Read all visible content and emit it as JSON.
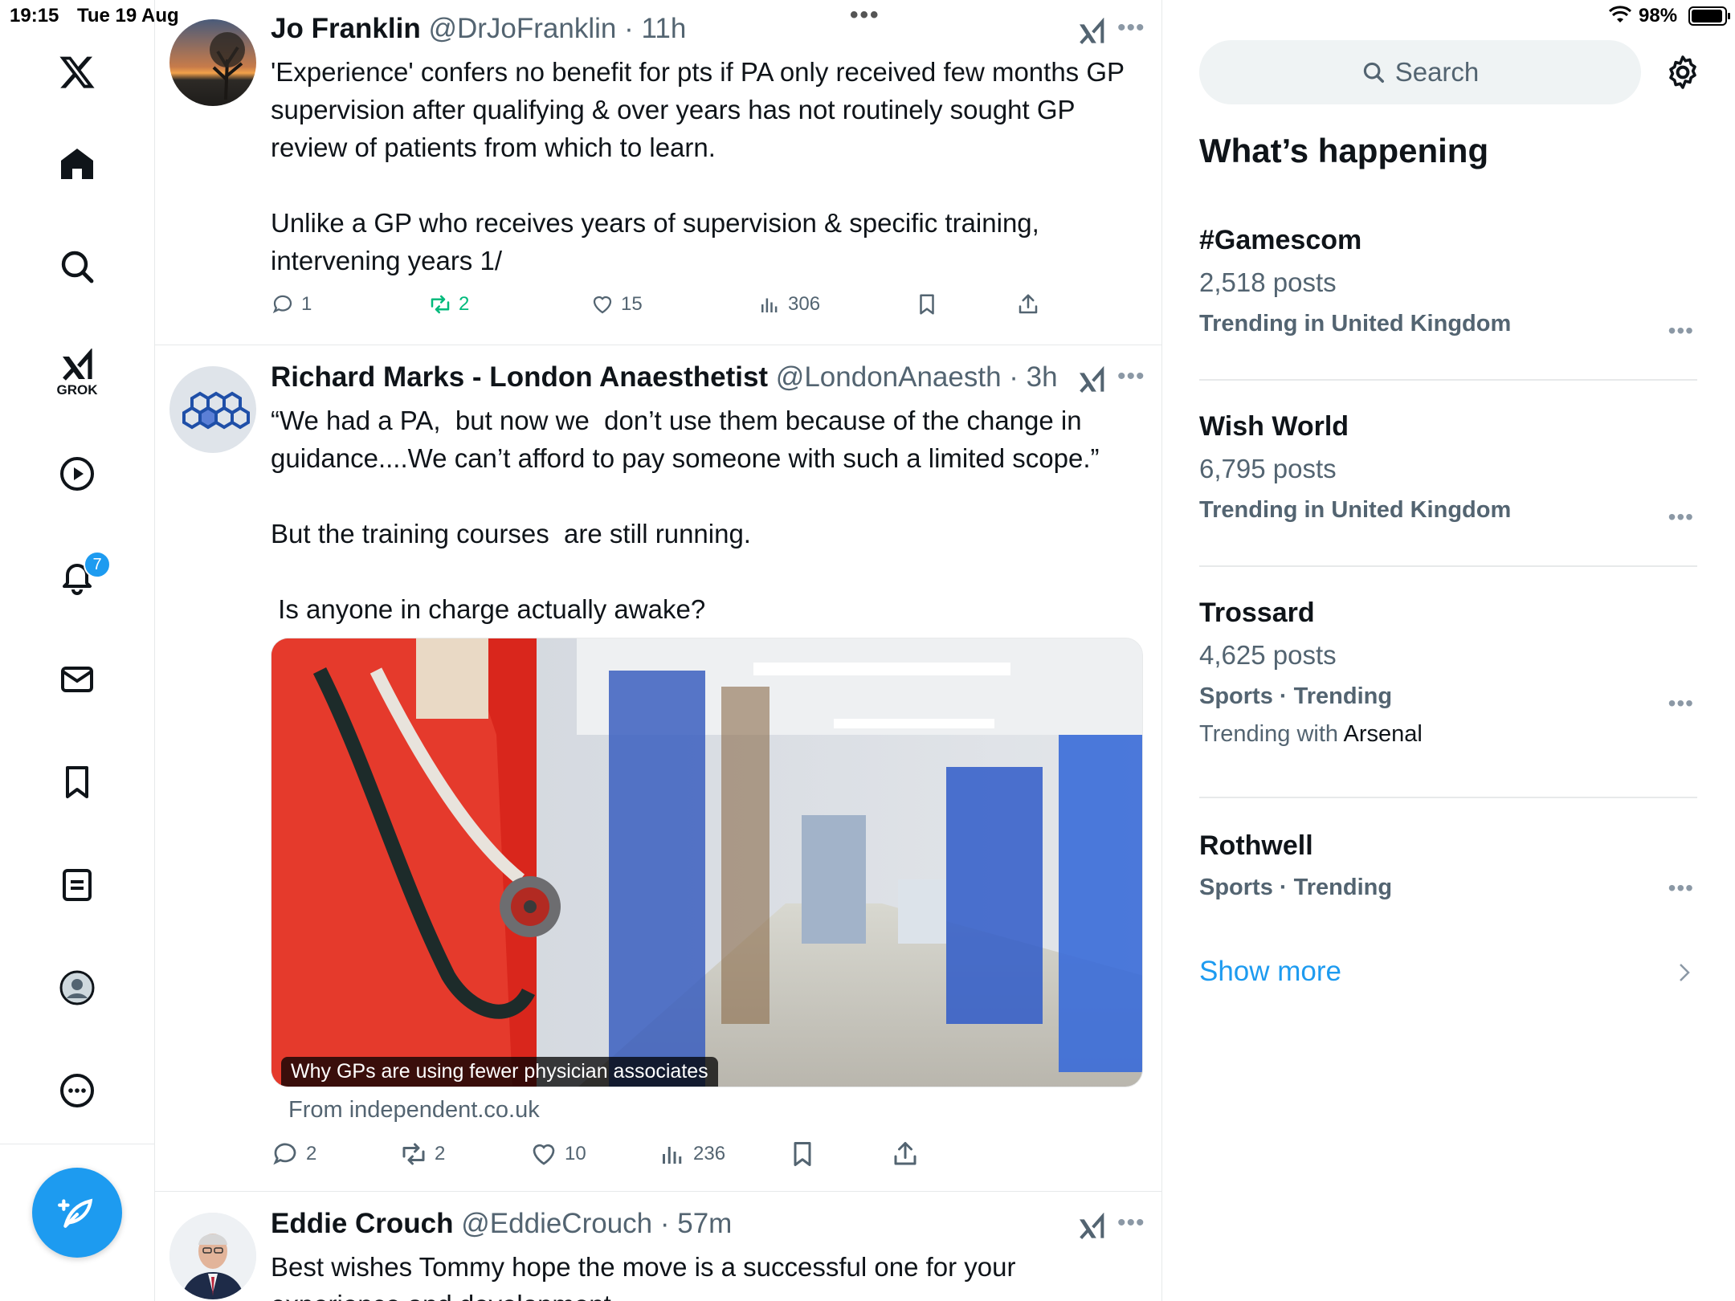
{
  "status": {
    "time": "19:15",
    "date": "Tue 19 Aug",
    "battery": "98%"
  },
  "nav": {
    "grok_label": "GROK",
    "notification_count": "7",
    "items": [
      "x-logo",
      "home",
      "explore",
      "grok",
      "video",
      "notifications",
      "messages",
      "bookmarks",
      "lists",
      "profile",
      "more"
    ]
  },
  "tweets": [
    {
      "name": "Jo Franklin",
      "handle": "@DrJoFranklin",
      "time": "11h",
      "text": "'Experience' confers no benefit for pts if PA only received few months GP supervision after qualifying & over years has not routinely sought GP review of patients from which to learn.\n\nUnlike a GP who receives years of supervision & specific training, intervening years 1/",
      "replies": "1",
      "reposts": "2",
      "likes": "15",
      "views": "306"
    },
    {
      "name": "Richard Marks - London Anaesthetist",
      "handle": "@LondonAnaesth",
      "time": "3h",
      "text": "“We had a PA,  but now we  don’t use them because of the change in guidance....We can’t afford to pay someone with such a limited scope.”\n\nBut the training courses  are still running.\n\n Is anyone in charge actually awake?",
      "card_caption": "Why GPs are using fewer physician associates",
      "card_source": "From independent.co.uk",
      "replies": "2",
      "reposts": "2",
      "likes": "10",
      "views": "236"
    },
    {
      "name": "Eddie Crouch",
      "handle": "@EddieCrouch",
      "time": "57m",
      "text": "Best wishes Tommy hope the move is a successful one for your experience and development"
    }
  ],
  "sidebar": {
    "search_placeholder": "Search",
    "section_title": "What’s happening",
    "trends": [
      {
        "name": "#Gamescom",
        "posts": "2,518 posts",
        "meta": "Trending in United Kingdom"
      },
      {
        "name": "Wish World",
        "posts": "6,795 posts",
        "meta": "Trending in United Kingdom"
      },
      {
        "name": "Trossard",
        "posts": "4,625 posts",
        "meta": "Sports · Trending",
        "with_prefix": "Trending with",
        "with_name": "Arsenal"
      },
      {
        "name": "Rothwell",
        "meta": "Sports · Trending"
      }
    ],
    "show_more": "Show more"
  },
  "colors": {
    "accent": "#1d9bf0",
    "repost_active": "#00ba7c",
    "secondary_text": "#536471",
    "divider": "#e7e9ea"
  }
}
